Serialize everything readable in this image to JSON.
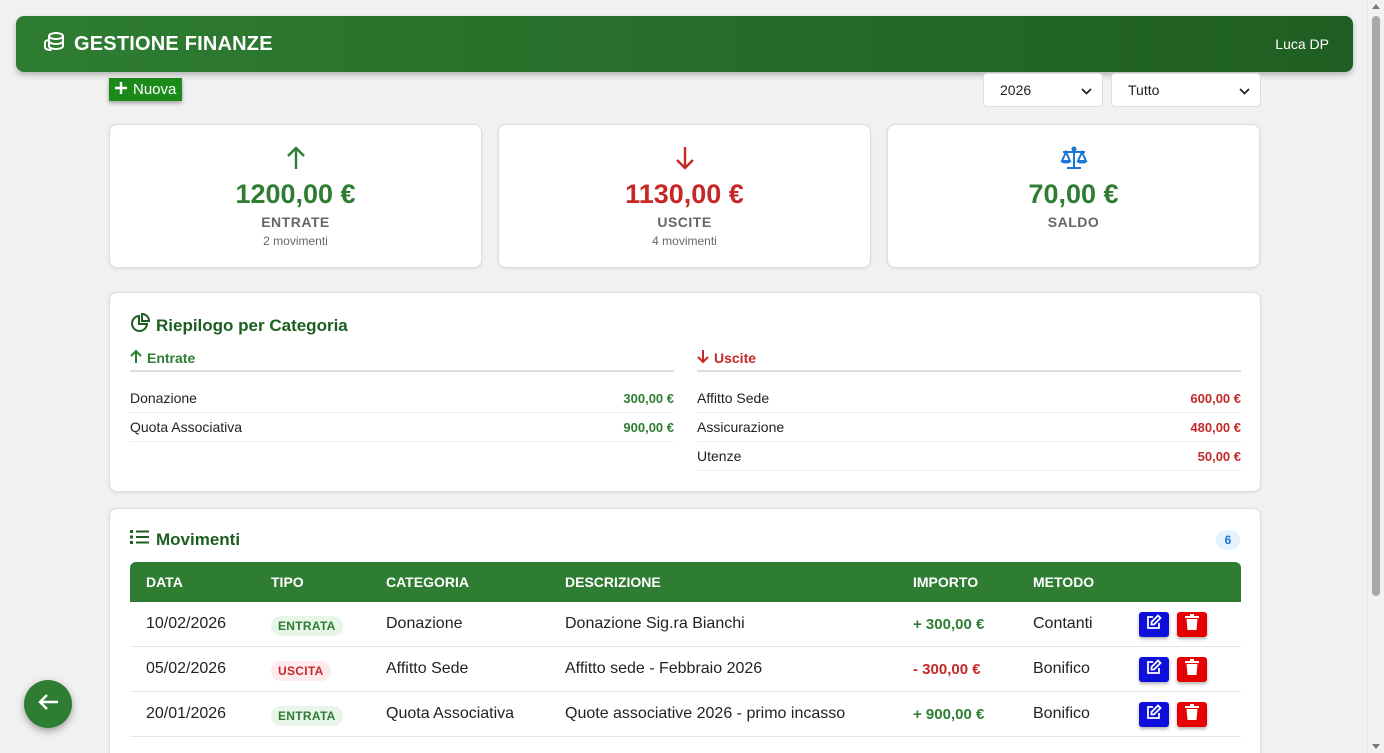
{
  "header": {
    "title": "GESTIONE FINANZE",
    "user": "Luca DP"
  },
  "toolbar": {
    "new_label": "Nuova",
    "year_select": {
      "selected": "2026"
    },
    "filter_select": {
      "selected": "Tutto"
    }
  },
  "stats": {
    "income": {
      "amount": "1200,00 €",
      "label": "ENTRATE",
      "sub": "2 movimenti"
    },
    "expense": {
      "amount": "1130,00 €",
      "label": "USCITE",
      "sub": "4 movimenti"
    },
    "balance": {
      "amount": "70,00 €",
      "label": "SALDO"
    }
  },
  "summary": {
    "title": "Riepilogo per Categoria",
    "income_title": "Entrate",
    "expense_title": "Uscite",
    "income_rows": [
      {
        "name": "Donazione",
        "value": "300,00 €"
      },
      {
        "name": "Quota Associativa",
        "value": "900,00 €"
      }
    ],
    "expense_rows": [
      {
        "name": "Affitto Sede",
        "value": "600,00 €"
      },
      {
        "name": "Assicurazione",
        "value": "480,00 €"
      },
      {
        "name": "Utenze",
        "value": "50,00 €"
      }
    ]
  },
  "movements": {
    "title": "Movimenti",
    "count": "6",
    "headers": {
      "date": "DATA",
      "type": "TIPO",
      "category": "CATEGORIA",
      "description": "DESCRIZIONE",
      "amount": "IMPORTO",
      "method": "METODO"
    },
    "rows": [
      {
        "date": "10/02/2026",
        "type": "ENTRATA",
        "category": "Donazione",
        "description": "Donazione Sig.ra Bianchi",
        "amount": "+ 300,00 €",
        "method": "Contanti"
      },
      {
        "date": "05/02/2026",
        "type": "USCITA",
        "category": "Affitto Sede",
        "description": "Affitto sede - Febbraio 2026",
        "amount": "- 300,00 €",
        "method": "Bonifico"
      },
      {
        "date": "20/01/2026",
        "type": "ENTRATA",
        "category": "Quota Associativa",
        "description": "Quote associative 2026 - primo incasso",
        "amount": "+ 900,00 €",
        "method": "Bonifico"
      }
    ]
  },
  "colors": {
    "primary": "#2e7d32",
    "income": "#2e7d32",
    "expense": "#c62828",
    "balance_icon": "#1976d2",
    "edit": "#0f0fdc",
    "delete": "#e60000"
  }
}
